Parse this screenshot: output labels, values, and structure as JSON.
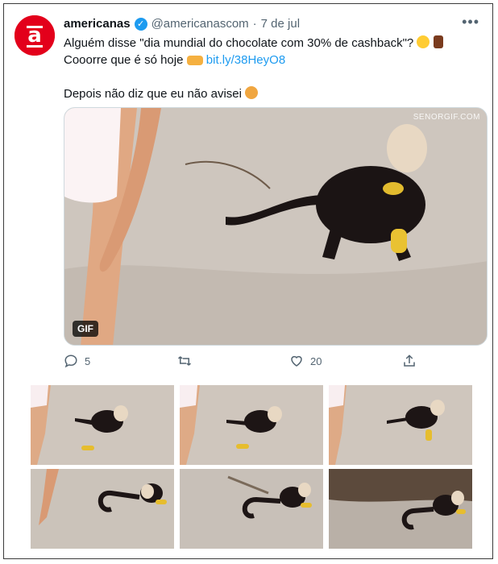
{
  "tweet": {
    "display_name": "americanas",
    "handle": "@americanascom",
    "separator": "·",
    "date": "7 de jul",
    "more": "•••",
    "line1": "Alguém disse \"dia mundial do chocolate com 30% de cashback\"?",
    "line2": "Cooorre que é só hoje",
    "link": "bit.ly/38HeyO8",
    "line3": "Depois não diz que eu não avisei",
    "media_badge": "GIF",
    "watermark": "SENORGIF.COM",
    "reply_count": "5",
    "like_count": "20"
  },
  "colors": {
    "brand_red": "#e3001b",
    "twitter_blue": "#1d9bf0",
    "muted": "#536471"
  },
  "icons": {
    "avatar": "americanas-logo-icon",
    "verified": "verified-badge-icon",
    "reply": "reply-icon",
    "retweet": "retweet-icon",
    "like": "heart-icon",
    "share": "share-icon"
  }
}
